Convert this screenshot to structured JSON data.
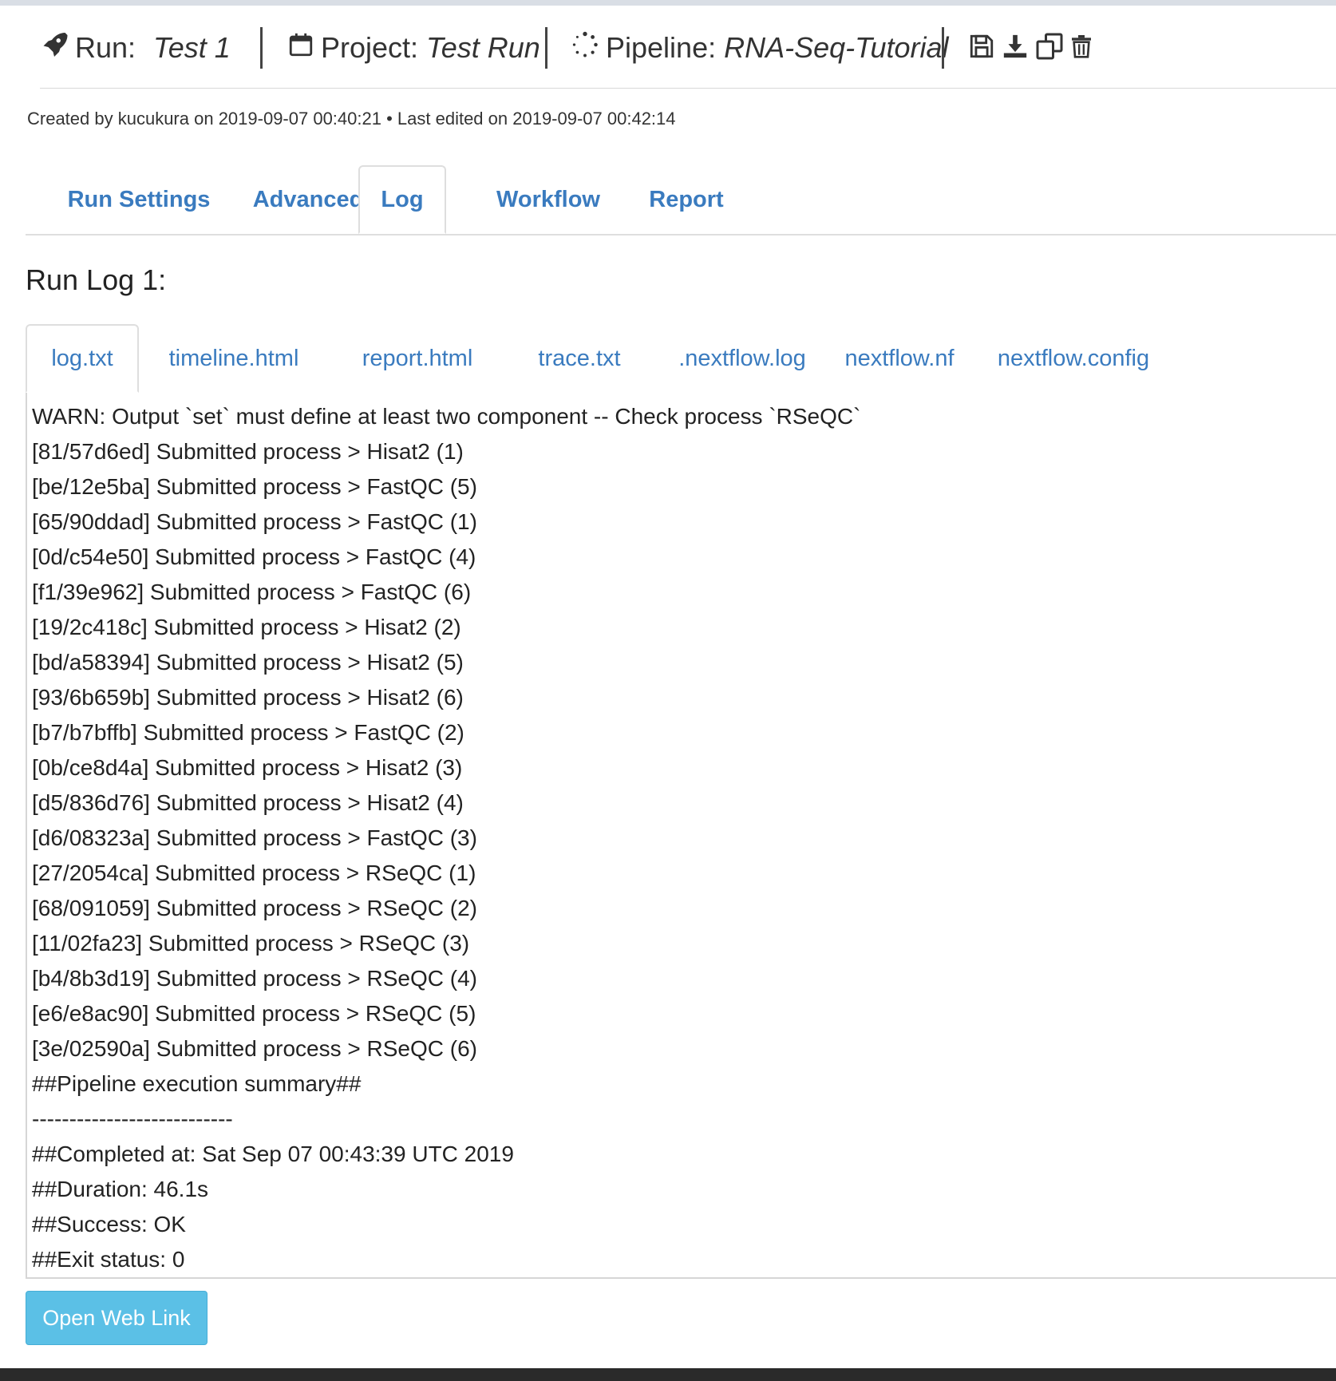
{
  "header": {
    "run_label": "Run:",
    "run_name": "Test 1",
    "project_label": "Project:",
    "project_name": "Test Run",
    "pipeline_label": "Pipeline:",
    "pipeline_name": "RNA-Seq-Tutorial",
    "icons": [
      "rocket-icon",
      "calendar-icon",
      "spinner-icon",
      "save-icon",
      "download-icon",
      "copy-icon",
      "trash-icon"
    ]
  },
  "meta": {
    "text": "Created by kucukura on 2019-09-07 00:40:21 • Last edited on 2019-09-07 00:42:14"
  },
  "main_tabs": [
    {
      "label": "Run Settings",
      "active": false
    },
    {
      "label": "Advanced",
      "active": false
    },
    {
      "label": "Log",
      "active": true
    },
    {
      "label": "Workflow",
      "active": false
    },
    {
      "label": "Report",
      "active": false
    }
  ],
  "run_log_title": "Run Log 1:",
  "file_tabs": [
    {
      "label": "log.txt",
      "active": true
    },
    {
      "label": "timeline.html",
      "active": false
    },
    {
      "label": "report.html",
      "active": false
    },
    {
      "label": "trace.txt",
      "active": false
    },
    {
      "label": ".nextflow.log",
      "active": false
    },
    {
      "label": "nextflow.nf",
      "active": false
    },
    {
      "label": "nextflow.config",
      "active": false
    }
  ],
  "log_lines": [
    "WARN: Output `set` must define at least two component -- Check process `RSeQC`",
    "[81/57d6ed] Submitted process > Hisat2 (1)",
    "[be/12e5ba] Submitted process > FastQC (5)",
    "[65/90ddad] Submitted process > FastQC (1)",
    "[0d/c54e50] Submitted process > FastQC (4)",
    "[f1/39e962] Submitted process > FastQC (6)",
    "[19/2c418c] Submitted process > Hisat2 (2)",
    "[bd/a58394] Submitted process > Hisat2 (5)",
    "[93/6b659b] Submitted process > Hisat2 (6)",
    "[b7/b7bffb] Submitted process > FastQC (2)",
    "[0b/ce8d4a] Submitted process > Hisat2 (3)",
    "[d5/836d76] Submitted process > Hisat2 (4)",
    "[d6/08323a] Submitted process > FastQC (3)",
    "[27/2054ca] Submitted process > RSeQC (1)",
    "[68/091059] Submitted process > RSeQC (2)",
    "[11/02fa23] Submitted process > RSeQC (3)",
    "[b4/8b3d19] Submitted process > RSeQC (4)",
    "[e6/e8ac90] Submitted process > RSeQC (5)",
    "[3e/02590a] Submitted process > RSeQC (6)",
    "##Pipeline execution summary##",
    "---------------------------",
    "##Completed at: Sat Sep 07 00:43:39 UTC 2019",
    "##Duration: 46.1s",
    "##Success: OK",
    "##Exit status: 0"
  ],
  "open_web_link_label": "Open Web Link",
  "colors": {
    "link_blue": "#3a7bbf",
    "button_blue": "#5bc0e6"
  }
}
